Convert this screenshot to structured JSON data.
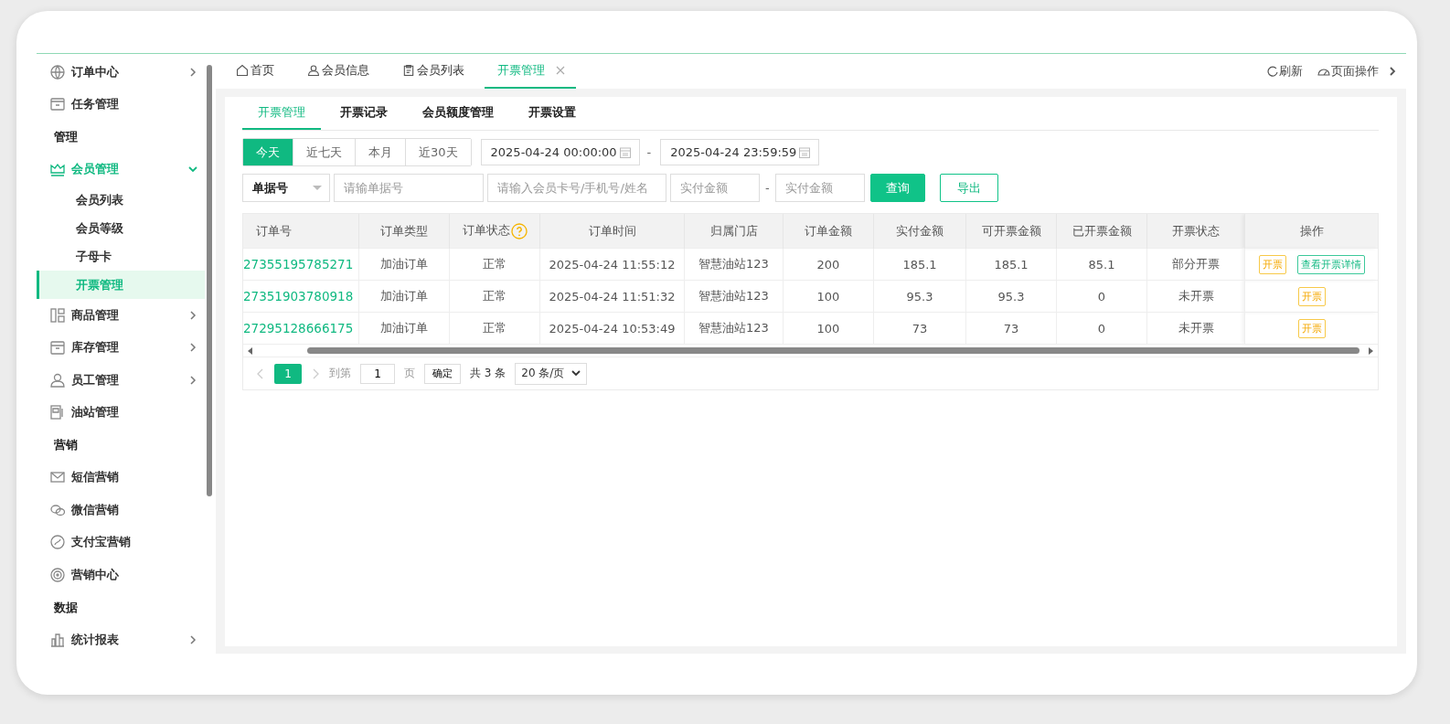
{
  "sidebar": {
    "items": [
      {
        "kind": "group",
        "label": "订单中心",
        "expanded": false,
        "selected": false
      },
      {
        "kind": "link",
        "label": "任务管理",
        "selected": false
      },
      {
        "kind": "section",
        "label": "管理"
      },
      {
        "kind": "group",
        "label": "会员管理",
        "expanded": true,
        "selected": true,
        "children": [
          {
            "label": "会员列表",
            "selected": false
          },
          {
            "label": "会员等级",
            "selected": false
          },
          {
            "label": "子母卡",
            "selected": false
          },
          {
            "label": "开票管理",
            "selected": true
          }
        ]
      },
      {
        "kind": "group",
        "label": "商品管理",
        "expanded": false,
        "selected": false
      },
      {
        "kind": "group",
        "label": "库存管理",
        "expanded": false,
        "selected": false
      },
      {
        "kind": "group",
        "label": "员工管理",
        "expanded": false,
        "selected": false
      },
      {
        "kind": "link",
        "label": "油站管理",
        "selected": false
      },
      {
        "kind": "section",
        "label": "营销"
      },
      {
        "kind": "link",
        "label": "短信营销",
        "selected": false
      },
      {
        "kind": "link",
        "label": "微信营销",
        "selected": false
      },
      {
        "kind": "link",
        "label": "支付宝营销",
        "selected": false
      },
      {
        "kind": "link",
        "label": "营销中心",
        "selected": false
      },
      {
        "kind": "section",
        "label": "数据"
      },
      {
        "kind": "group",
        "label": "统计报表",
        "expanded": false,
        "selected": false
      }
    ]
  },
  "page_tabs": [
    {
      "label": "首页",
      "selected": false,
      "closable": false
    },
    {
      "label": "会员信息",
      "selected": false,
      "closable": false
    },
    {
      "label": "会员列表",
      "selected": false,
      "closable": false
    },
    {
      "label": "开票管理",
      "selected": true,
      "closable": true
    }
  ],
  "toolbar": {
    "refresh": "刷新",
    "page_actions": "页面操作"
  },
  "sub_tabs": [
    {
      "label": "开票管理",
      "selected": true
    },
    {
      "label": "开票记录",
      "selected": false
    },
    {
      "label": "会员额度管理",
      "selected": false
    },
    {
      "label": "开票设置",
      "selected": false
    }
  ],
  "date_ranges": [
    {
      "label": "今天",
      "selected": true
    },
    {
      "label": "近七天",
      "selected": false
    },
    {
      "label": "本月",
      "selected": false
    },
    {
      "label": "近30天",
      "selected": false
    }
  ],
  "date_from": "2025-04-24 00:00:00",
  "date_to": "2025-04-24 23:59:59",
  "date_separator": "-",
  "amount_separator": "-",
  "filters": {
    "field_select": "单据号",
    "order_placeholder": "请输单据号",
    "member_placeholder": "请输入会员卡号/手机号/姓名",
    "amount_min_placeholder": "实付金额",
    "amount_max_placeholder": "实付金额",
    "search_button": "查询",
    "export_button": "导出"
  },
  "table": {
    "columns": [
      {
        "label": "订单号",
        "help": false
      },
      {
        "label": "订单类型",
        "help": false
      },
      {
        "label": "订单状态",
        "help": true
      },
      {
        "label": "订单时间",
        "help": false
      },
      {
        "label": "归属门店",
        "help": false
      },
      {
        "label": "订单金额",
        "help": false
      },
      {
        "label": "实付金额",
        "help": false
      },
      {
        "label": "可开票金额",
        "help": false
      },
      {
        "label": "已开票金额",
        "help": false
      },
      {
        "label": "开票状态",
        "help": false
      },
      {
        "label": "操作",
        "help": false
      }
    ],
    "rows": [
      {
        "cells": [
          "27355195785271",
          "加油订单",
          "正常",
          "2025-04-24 11:55:12",
          "智慧油站123",
          "200",
          "185.1",
          "185.1",
          "85.1",
          "部分开票"
        ],
        "actions": [
          {
            "kind": "invoice",
            "label": "开票"
          },
          {
            "kind": "detail",
            "label": "查看开票详情"
          }
        ]
      },
      {
        "cells": [
          "27351903780918",
          "加油订单",
          "正常",
          "2025-04-24 11:51:32",
          "智慧油站123",
          "100",
          "95.3",
          "95.3",
          "0",
          "未开票"
        ],
        "actions": [
          {
            "kind": "invoice",
            "label": "开票"
          }
        ]
      },
      {
        "cells": [
          "27295128666175",
          "加油订单",
          "正常",
          "2025-04-24 10:53:49",
          "智慧油站123",
          "100",
          "73",
          "73",
          "0",
          "未开票"
        ],
        "actions": [
          {
            "kind": "invoice",
            "label": "开票"
          }
        ]
      }
    ]
  },
  "pagination": {
    "pages": [
      {
        "label": "1",
        "selected": true
      }
    ],
    "goto_label": "到第",
    "goto_value": "1",
    "page_unit": "页",
    "confirm": "确定",
    "total": "共 3 条",
    "page_size": "20 条/页"
  }
}
